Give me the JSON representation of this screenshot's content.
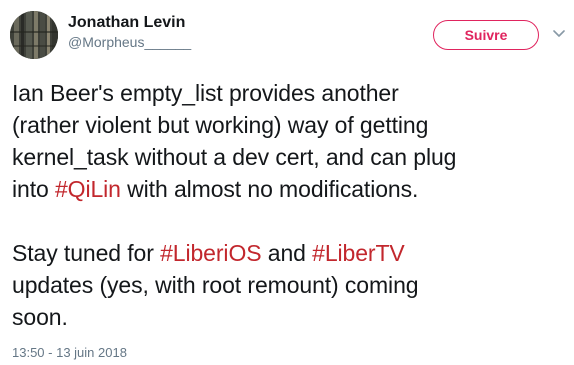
{
  "author": {
    "display_name": "Jonathan Levin",
    "handle": "@Morpheus______"
  },
  "follow_button": {
    "label": "Suivre"
  },
  "tweet": {
    "line1": "Ian Beer's empty_list provides another",
    "line2": "(rather violent but working) way of getting",
    "line3": "kernel_task without a dev cert, and can plug",
    "line4_pre": "into ",
    "hashtag_qilin": "#QiLin",
    "line4_post": " with almost no modifications.",
    "line5_pre": "Stay tuned for ",
    "hashtag_liberios": "#LiberiOS",
    "line5_mid": " and ",
    "hashtag_libertv": "#LiberTV",
    "line6": "updates (yes, with root remount) coming",
    "line7": "soon."
  },
  "timestamp": "13:50 - 13 juin 2018",
  "icons": {
    "menu": "chevron-down-icon"
  },
  "colors": {
    "accent": "#e0245e",
    "hashtag": "#c2272d",
    "secondary_text": "#657786",
    "primary_text": "#14171a"
  }
}
